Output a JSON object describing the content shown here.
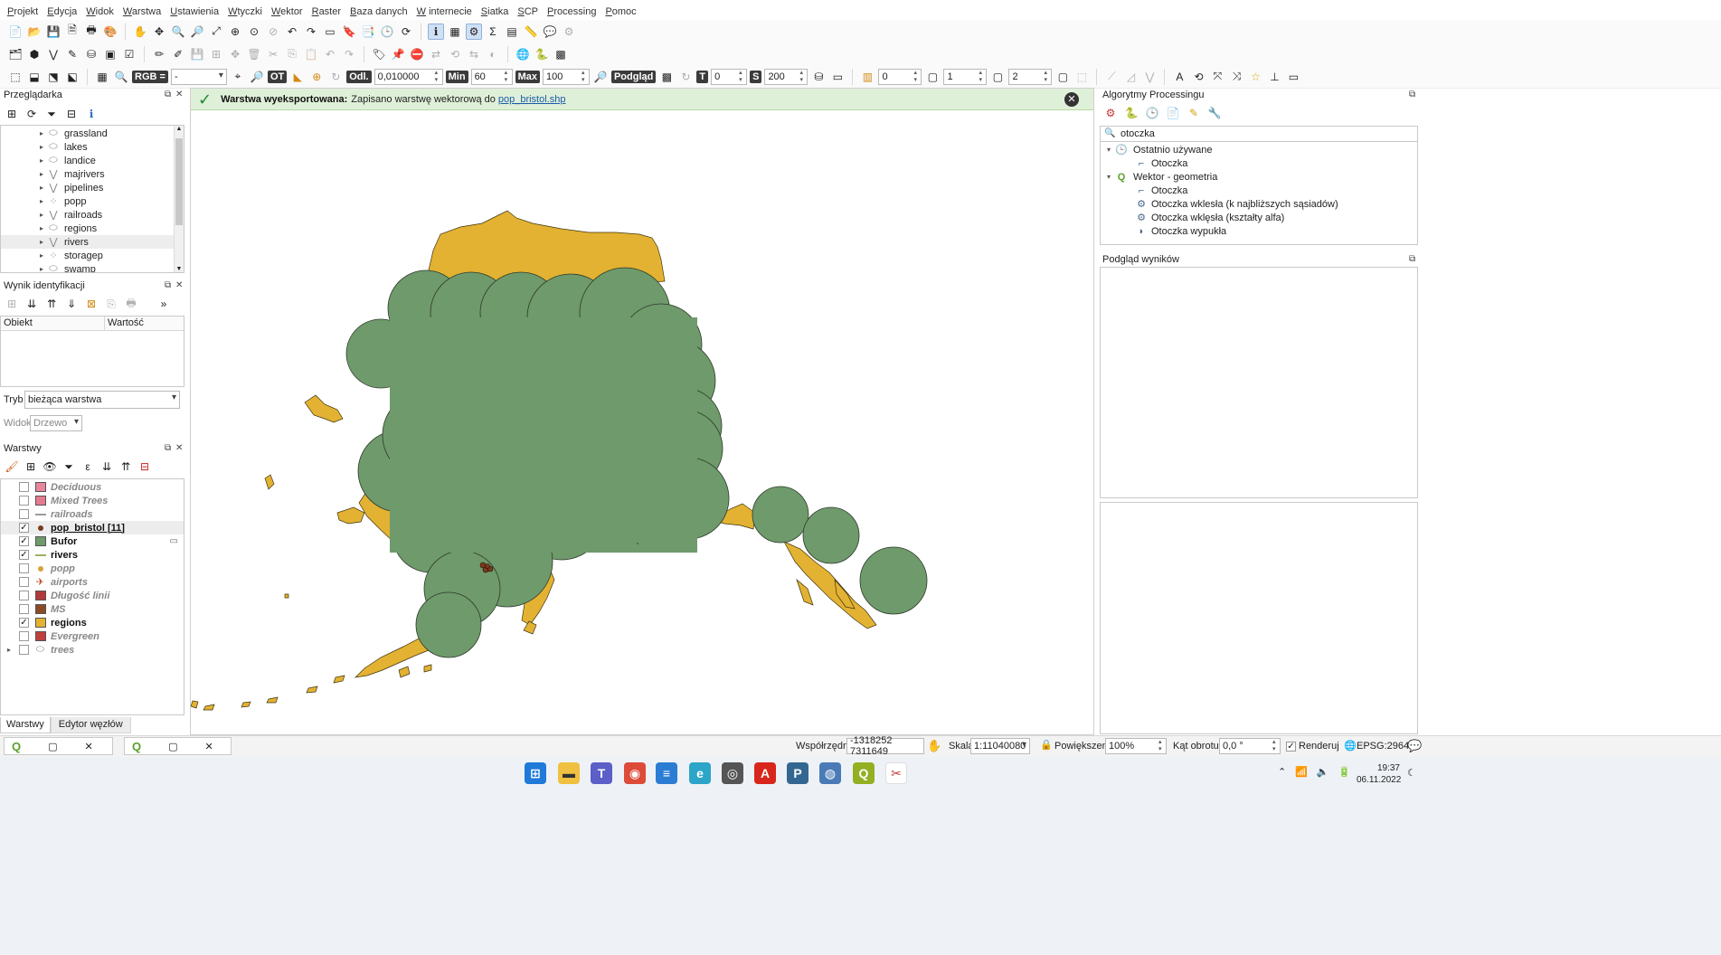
{
  "menu": [
    "Projekt",
    "Edycja",
    "Widok",
    "Warstwa",
    "Ustawienia",
    "Wtyczki",
    "Wektor",
    "Raster",
    "Baza danych",
    "W internecie",
    "Siatka",
    "SCP",
    "Processing",
    "Pomoc"
  ],
  "toolbar3": {
    "rgb_label": "RGB =",
    "rgb_value": "-",
    "ot_label": "OT",
    "odl_label": "Odl.",
    "odl_value": "0,010000",
    "min_label": "Min",
    "min_value": "60",
    "max_label": "Max",
    "max_value": "100",
    "preview_label": "Podgląd",
    "t_label": "T",
    "t_value": "0",
    "s_label": "S",
    "s_value": "200",
    "spin_a": "0",
    "spin_b": "1",
    "spin_c": "2"
  },
  "browser": {
    "title": "Przeglądarka",
    "items": [
      {
        "label": "grassland",
        "icon": "polygon-layer-icon"
      },
      {
        "label": "lakes",
        "icon": "polygon-layer-icon"
      },
      {
        "label": "landice",
        "icon": "polygon-layer-icon"
      },
      {
        "label": "majrivers",
        "icon": "line-layer-icon"
      },
      {
        "label": "pipelines",
        "icon": "line-layer-icon"
      },
      {
        "label": "popp",
        "icon": "point-layer-icon"
      },
      {
        "label": "railroads",
        "icon": "line-layer-icon"
      },
      {
        "label": "regions",
        "icon": "polygon-layer-icon"
      },
      {
        "label": "rivers",
        "icon": "line-layer-icon"
      },
      {
        "label": "storagep",
        "icon": "point-layer-icon"
      },
      {
        "label": "swamp",
        "icon": "polygon-layer-icon"
      }
    ]
  },
  "identify": {
    "title": "Wynik identyfikacji",
    "col_object": "Obiekt",
    "col_value": "Wartość",
    "mode_label": "Tryb",
    "mode_value": "bieżąca warstwa",
    "view_label": "Widok",
    "view_value": "Drzewo"
  },
  "layers": {
    "title": "Warstwy",
    "items": [
      {
        "label": "Deciduous",
        "checked": false,
        "color": "#e8869b",
        "kind": "fill"
      },
      {
        "label": "Mixed Trees",
        "checked": false,
        "color": "#e57a8f",
        "kind": "fill"
      },
      {
        "label": "railroads",
        "checked": false,
        "color": "#9a9a9a",
        "kind": "line"
      },
      {
        "label": "pop_bristol [11]",
        "checked": true,
        "color": "#7a3b1d",
        "kind": "dot"
      },
      {
        "label": "Bufor",
        "checked": true,
        "color": "#6f9a6b",
        "kind": "fill"
      },
      {
        "label": "rivers",
        "checked": true,
        "color": "#9bb15c",
        "kind": "line"
      },
      {
        "label": "popp",
        "checked": false,
        "color": "#d9a23a",
        "kind": "dot"
      },
      {
        "label": "airports",
        "checked": false,
        "color": "#c0502a",
        "kind": "plane"
      },
      {
        "label": "Długość linii",
        "checked": false,
        "color": "#b23a3a",
        "kind": "fill"
      },
      {
        "label": "MS",
        "checked": false,
        "color": "#8b4a23",
        "kind": "fill"
      },
      {
        "label": "regions",
        "checked": true,
        "color": "#e3b232",
        "kind": "fill"
      },
      {
        "label": "Evergreen",
        "checked": false,
        "color": "#c0403c",
        "kind": "fill"
      },
      {
        "label": "trees",
        "checked": false,
        "color": "#999999",
        "kind": "group"
      }
    ],
    "tab_layers": "Warstwy",
    "tab_nodes": "Edytor węzłów"
  },
  "message": {
    "title": "Warstwa wyeksportowana:",
    "text": "Zapisano warstwę wektorową do",
    "link": "pop_bristol.shp"
  },
  "processing": {
    "title": "Algorytmy Processingu",
    "search": "otoczka",
    "groups": [
      {
        "label": "Ostatnio używane",
        "icon": "clock-icon",
        "items": [
          "Otoczka"
        ]
      },
      {
        "label": "Wektor - geometria",
        "icon": "qgis-icon",
        "items": [
          "Otoczka",
          "Otoczka wklesła (k najbliższych sąsiadów)",
          "Otoczka wklęsła (kształty alfa)",
          "Otoczka wypukła"
        ]
      }
    ]
  },
  "results": {
    "title": "Podgląd wyników"
  },
  "statusbar": {
    "coords_label": "Współrzędne",
    "coords_value": "-1318252 7311649",
    "scale_label": "Skala",
    "scale_value": "1:11040080",
    "zoom_label": "Powiększenie",
    "zoom_value": "100%",
    "rotation_label": "Kąt obrotu",
    "rotation_value": "0,0 °",
    "render_label": "Renderuj",
    "crs": "EPSG:2964"
  },
  "clock": {
    "time": "19:37",
    "date": "06.11.2022"
  },
  "colors": {
    "buffer": "#6f9a6b",
    "regions": "#e3b232",
    "msg_bg": "#dff0d8"
  }
}
